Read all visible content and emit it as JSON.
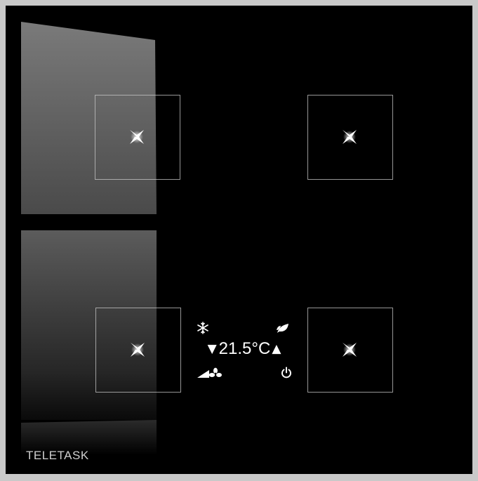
{
  "device": {
    "brand": "TELETASK",
    "accent_color": "#ffffff",
    "panel_color": "#000000"
  },
  "keys": [
    {
      "icon": "star-led-icon"
    },
    {
      "icon": "star-led-icon"
    },
    {
      "icon": "star-led-icon"
    },
    {
      "icon": "star-led-icon"
    }
  ],
  "thermostat": {
    "temperature": "21.5°C",
    "down_arrow": "▼",
    "up_arrow": "▲",
    "icons": [
      "snowflake-icon",
      "leaf-icon",
      "fan-speed-icon",
      "power-icon"
    ]
  }
}
